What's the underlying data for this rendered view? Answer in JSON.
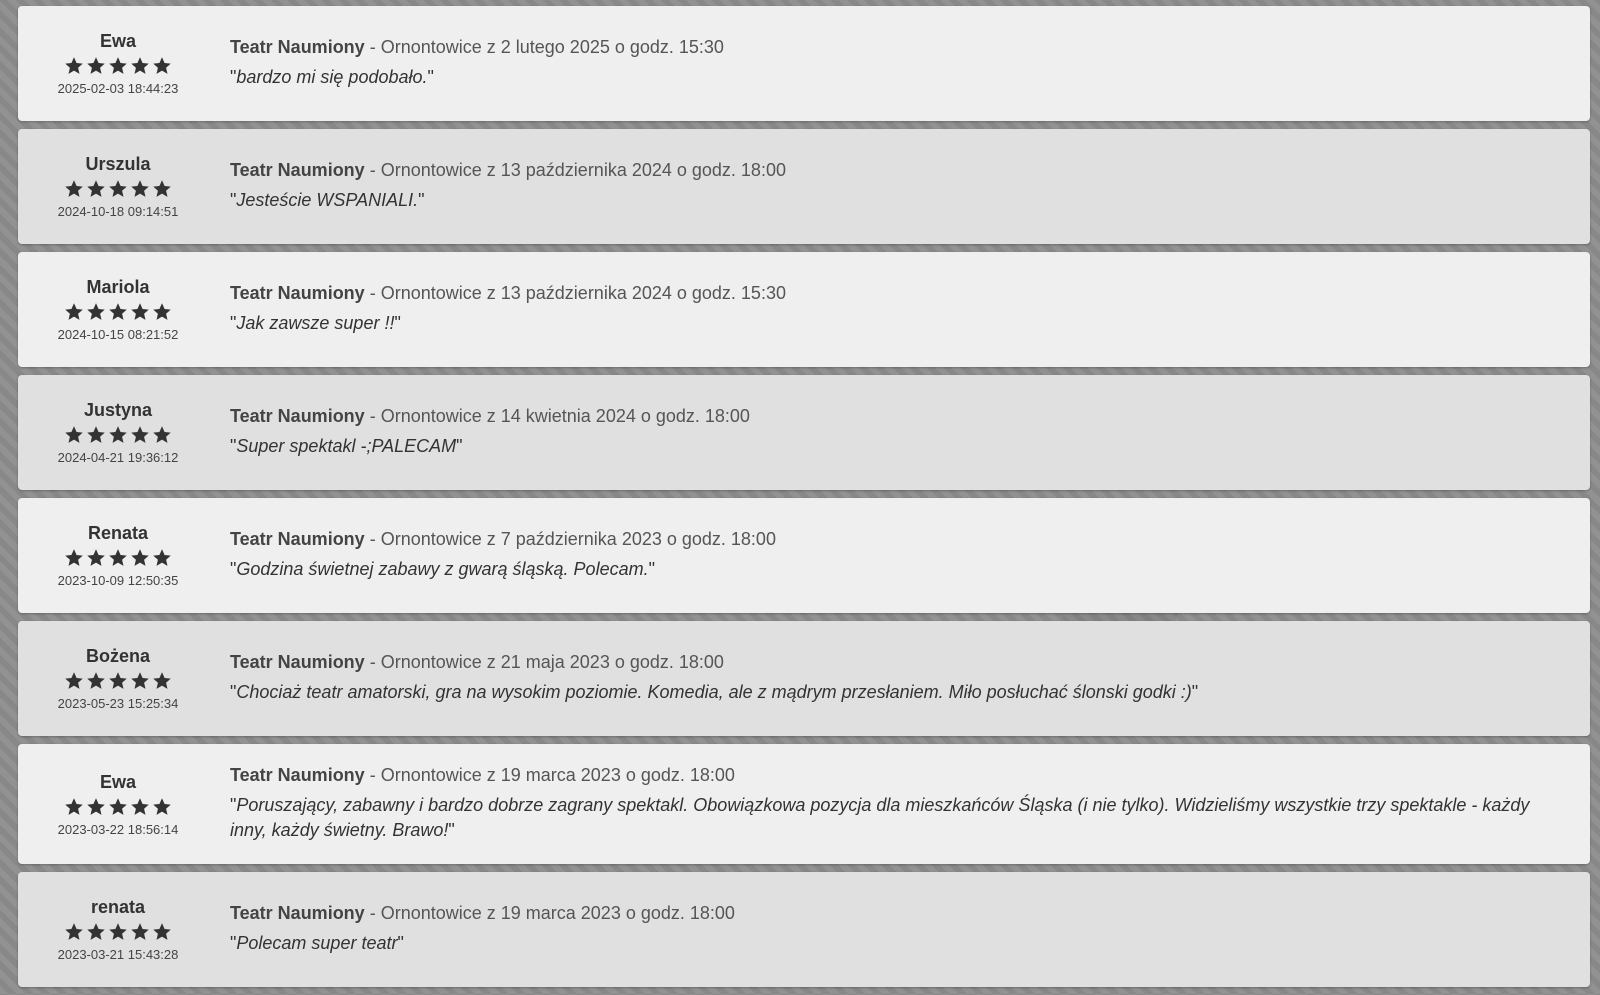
{
  "reviews": [
    {
      "author": "Ewa",
      "rating": 5,
      "date": "2025-02-03 18:44:23",
      "theatre": "Teatr Naumiony",
      "event": " - Ornontowice z 2 lutego 2025 o godz. 15:30",
      "text": "bardzo mi się podobało."
    },
    {
      "author": "Urszula",
      "rating": 5,
      "date": "2024-10-18 09:14:51",
      "theatre": "Teatr Naumiony",
      "event": " - Ornontowice z 13 października 2024 o godz. 18:00",
      "text": "Jesteście WSPANIALI."
    },
    {
      "author": "Mariola",
      "rating": 5,
      "date": "2024-10-15 08:21:52",
      "theatre": "Teatr Naumiony",
      "event": " - Ornontowice z 13 października 2024 o godz. 15:30",
      "text": "Jak zawsze super !!"
    },
    {
      "author": "Justyna",
      "rating": 5,
      "date": "2024-04-21 19:36:12",
      "theatre": "Teatr Naumiony",
      "event": " - Ornontowice z 14 kwietnia 2024 o godz. 18:00",
      "text": "Super spektakl -;PALECAM"
    },
    {
      "author": "Renata",
      "rating": 5,
      "date": "2023-10-09 12:50:35",
      "theatre": "Teatr Naumiony",
      "event": " - Ornontowice z 7 października 2023 o godz. 18:00",
      "text": "Godzina świetnej zabawy z gwarą śląską. Polecam."
    },
    {
      "author": "Bożena",
      "rating": 5,
      "date": "2023-05-23 15:25:34",
      "theatre": "Teatr Naumiony",
      "event": " - Ornontowice z 21 maja 2023 o godz. 18:00",
      "text": "Chociaż teatr amatorski, gra na wysokim poziomie. Komedia, ale z mądrym przesłaniem. Miło posłuchać ślonski godki :)"
    },
    {
      "author": "Ewa",
      "rating": 5,
      "date": "2023-03-22 18:56:14",
      "theatre": "Teatr Naumiony",
      "event": " - Ornontowice z 19 marca 2023 o godz. 18:00",
      "text": "Poruszający, zabawny i bardzo dobrze zagrany spektakl. Obowiązkowa pozycja dla mieszkańców Śląska (i nie tylko). Widzieliśmy wszystkie trzy spektakle - każdy inny, każdy świetny. Brawo!"
    },
    {
      "author": "renata",
      "rating": 5,
      "date": "2023-03-21 15:43:28",
      "theatre": "Teatr Naumiony",
      "event": " - Ornontowice z 19 marca 2023 o godz. 18:00",
      "text": "Polecam super teatr"
    }
  ],
  "icons": {
    "star": "star-icon"
  },
  "colors": {
    "star": "#333333",
    "row_light": "#efefef",
    "row_dark": "#e0e0e0"
  }
}
